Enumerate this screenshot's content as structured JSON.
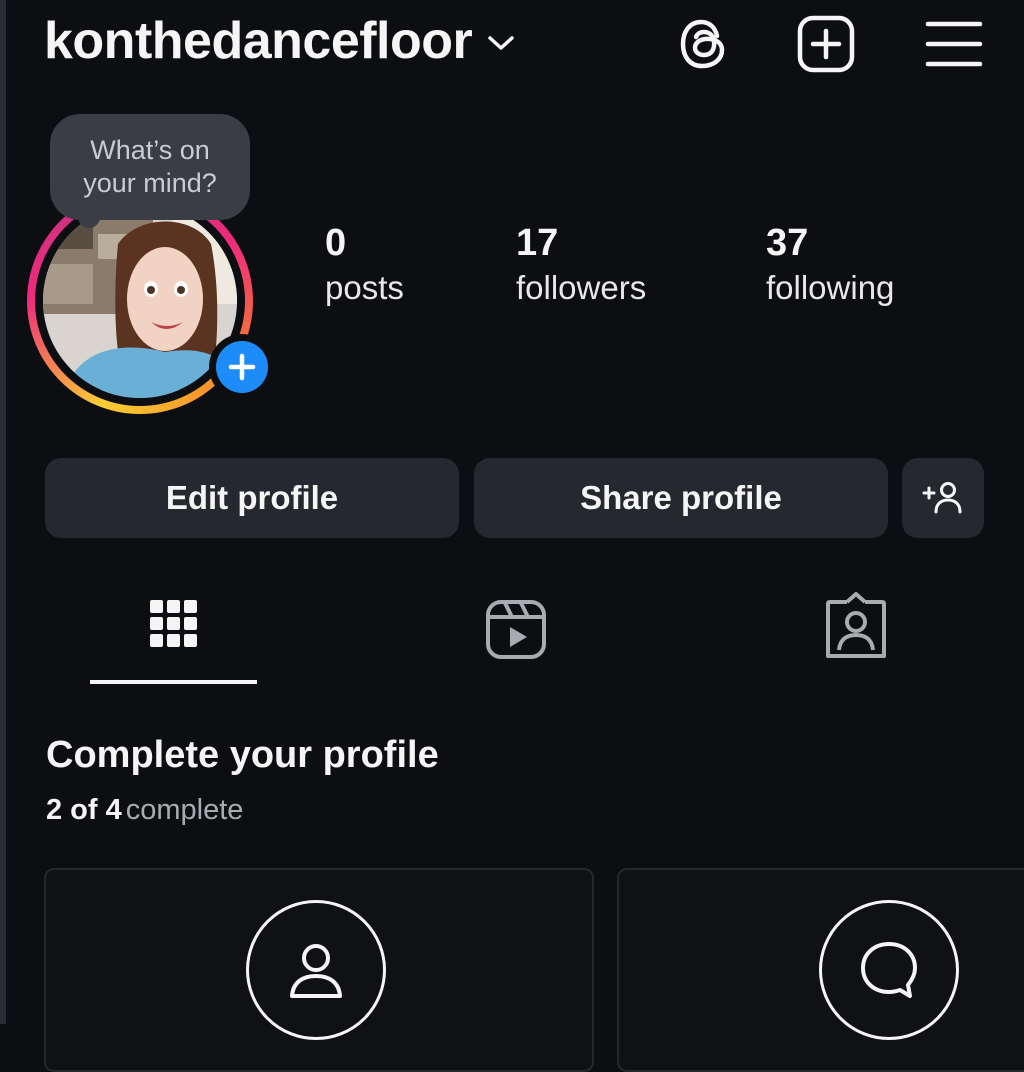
{
  "header": {
    "username": "konthedancefloor",
    "icons": [
      "chevron-down-icon",
      "threads-icon",
      "create-post-icon",
      "menu-icon"
    ]
  },
  "profile": {
    "note_prompt": "What’s on your mind?",
    "note_line1": "What’s on",
    "note_line2": "your mind?",
    "stats": [
      {
        "value": "0",
        "label": "posts"
      },
      {
        "value": "17",
        "label": "followers"
      },
      {
        "value": "37",
        "label": "following"
      }
    ]
  },
  "actions": {
    "edit_label": "Edit profile",
    "share_label": "Share profile",
    "add_person_icon": "add-person-icon"
  },
  "tabs": [
    {
      "icon": "grid-icon",
      "active": true
    },
    {
      "icon": "reels-icon",
      "active": false
    },
    {
      "icon": "tagged-icon",
      "active": false
    }
  ],
  "complete_profile": {
    "title": "Complete your profile",
    "count": "2 of 4",
    "status": "complete",
    "cards": [
      {
        "icon": "person-icon"
      },
      {
        "icon": "speech-bubble-icon"
      }
    ]
  },
  "colors": {
    "background": "#0c0e12",
    "button": "#25282e",
    "accent_blue": "#1d8cf8",
    "ring_start": "#f9ce34",
    "ring_mid": "#ee2a7b"
  }
}
